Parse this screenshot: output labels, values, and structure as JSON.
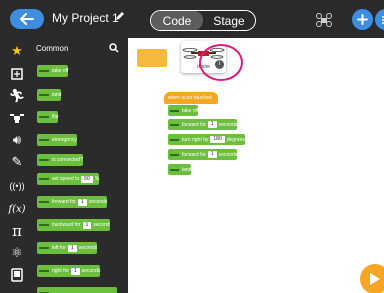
{
  "header": {
    "project_title": "My Project 1",
    "tabs": [
      {
        "label": "Code",
        "active": true
      },
      {
        "label": "Stage",
        "active": false
      }
    ]
  },
  "sidebar": {
    "category_label": "Common",
    "categories": [
      "star-icon",
      "takeoff-icon",
      "run-icon",
      "drone-icon",
      "sound-icon",
      "pencil-icon",
      "signal-icon",
      "function-icon",
      "pi-icon",
      "atom-icon",
      "device-icon"
    ],
    "blocks": [
      {
        "text": "take off"
      },
      {
        "text": "land"
      },
      {
        "text": "flip"
      },
      {
        "text": "emergency"
      },
      {
        "text": "is connected?"
      },
      {
        "text": "set speed to",
        "value": "50",
        "suffix": "%"
      },
      {
        "text": "forward for",
        "value": "1",
        "suffix": "seconds"
      },
      {
        "text": "backward for",
        "value": "1",
        "suffix": "second"
      },
      {
        "text": "left for",
        "value": "1",
        "suffix": "seconds"
      },
      {
        "text": "right for",
        "value": "1",
        "suffix": "seconds"
      }
    ]
  },
  "canvas": {
    "actor_name": "drone",
    "script": {
      "hat": "when actor touched",
      "blocks": [
        {
          "text": "take off"
        },
        {
          "text": "forward for",
          "value": "1",
          "suffix": "seconds"
        },
        {
          "text": "turn right by",
          "value": "180",
          "suffix": "degrees"
        },
        {
          "text": "forward for",
          "value": "1",
          "suffix": "seconds"
        },
        {
          "text": "land"
        }
      ]
    }
  },
  "colors": {
    "topbar": "#2a2a2a",
    "accent_blue": "#3d8de0",
    "block_green": "#6cbf3c",
    "hat_orange": "#f5a623",
    "highlight_pink": "#e0197d"
  }
}
